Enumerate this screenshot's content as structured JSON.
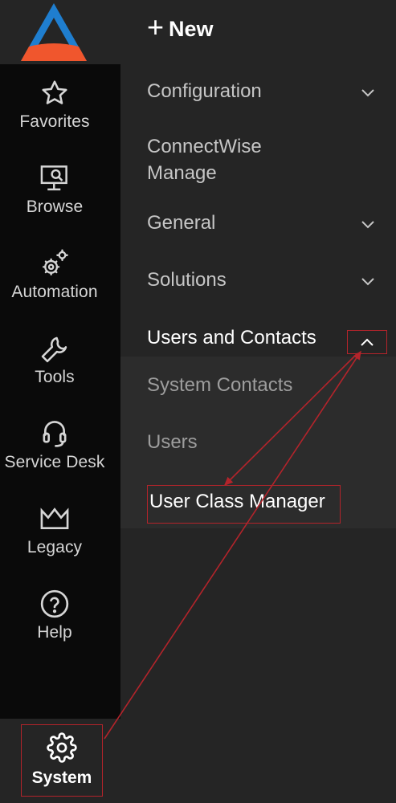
{
  "new_button": {
    "label": "New"
  },
  "rail": {
    "items": [
      {
        "label": "Favorites",
        "icon": "star-icon"
      },
      {
        "label": "Browse",
        "icon": "monitor-search-icon"
      },
      {
        "label": "Automation",
        "icon": "gears-icon"
      },
      {
        "label": "Tools",
        "icon": "wrench-icon"
      },
      {
        "label": "Service Desk",
        "icon": "headset-icon"
      },
      {
        "label": "Legacy",
        "icon": "crown-icon"
      },
      {
        "label": "Help",
        "icon": "question-circle-icon"
      }
    ],
    "system": {
      "label": "System",
      "icon": "gear-icon"
    }
  },
  "menu": {
    "configuration": "Configuration",
    "connectwise_line1": "ConnectWise",
    "connectwise_line2": "Manage",
    "general": "General",
    "solutions": "Solutions",
    "users_and_contacts": "Users and Contacts",
    "sub_items": [
      "System Contacts",
      "Users",
      "User Class Manager"
    ]
  },
  "colors": {
    "rail_bg": "#0a0a0a",
    "panel_bg": "#252525",
    "subpanel_bg": "#2c2c2c",
    "annotation_red": "#b3242b",
    "logo_blue": "#1f7ecf",
    "logo_orange": "#f0562d"
  }
}
